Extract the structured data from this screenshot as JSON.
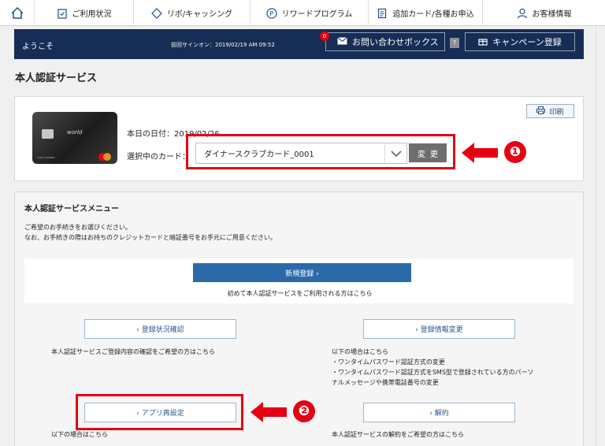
{
  "nav": {
    "items": [
      {
        "label": "ご利用状況",
        "icon": "clipboard-check-icon"
      },
      {
        "label": "リボ/キャッシング",
        "icon": "exchange-icon"
      },
      {
        "label": "リワードプログラム",
        "icon": "points-icon"
      },
      {
        "label": "追加カード/各種お申込",
        "icon": "document-icon"
      },
      {
        "label": "お客様情報",
        "icon": "user-icon"
      }
    ]
  },
  "welcome": {
    "greeting": "ようこそ",
    "last_signin": "前回サインオン：2019/02/19 AM 09:52",
    "inquiry_label": "お問い合わせボックス",
    "inquiry_badge": "0",
    "help_label": "?",
    "campaign_label": "キャンペーン登録"
  },
  "page_title": "本人認証サービス",
  "card_panel": {
    "today": "本日の日付：2019/02/26",
    "card_label": "選択中のカード：",
    "selected_card": "ダイナースクラブカード_0001",
    "change_label": "変更",
    "print_label": "印刷",
    "card_brand_text": "world",
    "card_member_text": "CARD MEMBER"
  },
  "menu": {
    "title": "本人認証サービスメニュー",
    "desc_line1": "ご希望のお手続きをお選びください。",
    "desc_line2": "なお、お手続きの際はお持ちのクレジットカードと暗証番号をお手元にご用意ください。",
    "register_label": "新規登録 ›",
    "register_note": "初めて本人認証サービスをご利用される方はこちら",
    "status_check_label": "› 登録状況確認",
    "status_check_note": "本人認証サービスご登録内容の確認をご希望の方はこちら",
    "info_change_label": "› 登録情報変更",
    "info_change_note_1": "以下の場合はこちら",
    "info_change_note_2": "・ワンタイムパスワード認証方式の変更",
    "info_change_note_3": "・ワンタイムパスワード認証方式をSMS型で登録されている方のパーソ",
    "info_change_note_4": "ナルメッセージや携帯電話番号の変更",
    "app_reset_label": "› アプリ再設定",
    "app_reset_note": "以下の場合はこちら",
    "cancel_label": "› 解約",
    "cancel_note": "本人認証サービスの解約をご希望の方はこちら"
  },
  "annotations": {
    "step1": "❶",
    "step2": "❷"
  },
  "colors": {
    "navy": "#162d55",
    "accent_blue": "#2a6aa8",
    "annotation_red": "#e60012"
  }
}
